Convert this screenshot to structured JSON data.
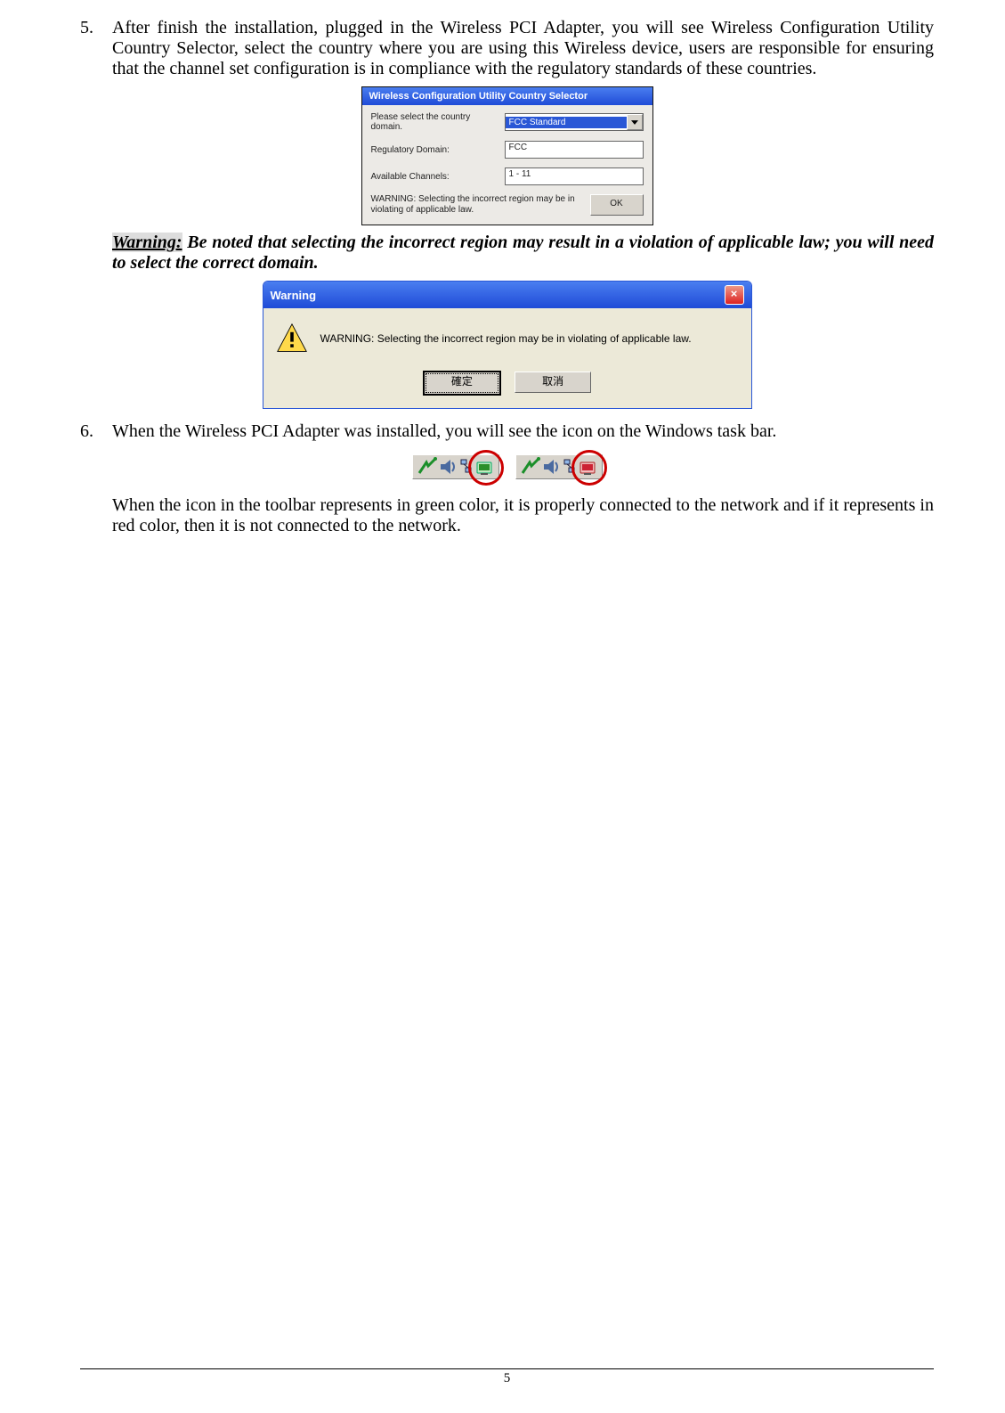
{
  "step5": {
    "num": "5.",
    "text": "After finish the installation, plugged in the Wireless PCI Adapter, you will see Wireless Configuration Utility Country Selector, select the country where you are using this Wireless device, users are responsible for ensuring that the channel set configuration is in compliance with the regulatory standards of these countries."
  },
  "dialog1": {
    "title": "Wireless Configuration Utility Country Selector",
    "prompt": "Please select the country domain.",
    "selected_value": "FCC Standard",
    "reg_label": "Regulatory Domain:",
    "reg_value": "FCC",
    "chan_label": "Available Channels:",
    "chan_value": "1 - 11",
    "warn_text": "WARNING: Selecting the incorrect region may be in violating of applicable law.",
    "ok_label": "OK"
  },
  "warning_inline": {
    "label": "Warning:",
    "text": " Be noted that selecting the incorrect region may result in a violation of applicable law; you will need to select the correct domain."
  },
  "dialog2": {
    "title": "Warning",
    "message": "WARNING: Selecting the incorrect region may be in violating of applicable law.",
    "ok": "確定",
    "cancel": "取消",
    "close": "×"
  },
  "step6": {
    "num": "6.",
    "text": "When the Wireless PCI Adapter was installed, you will see the icon on the Windows task bar."
  },
  "taskbar_note": "When the icon in the toolbar represents in green color, it is properly connected to the network and if it represents in red color, then it is not connected to the network.",
  "page_number": "5"
}
